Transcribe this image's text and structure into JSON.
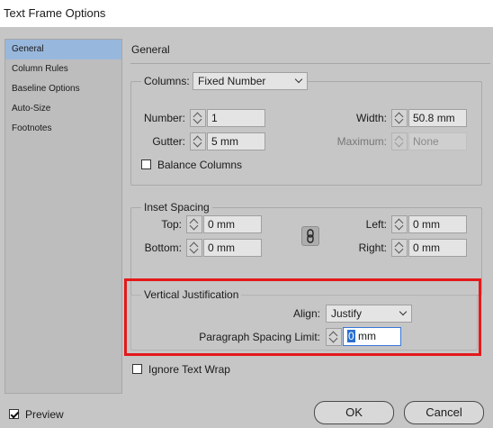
{
  "window": {
    "title": "Text Frame Options"
  },
  "sidebar": {
    "items": [
      {
        "label": "General"
      },
      {
        "label": "Column Rules"
      },
      {
        "label": "Baseline Options"
      },
      {
        "label": "Auto-Size"
      },
      {
        "label": "Footnotes"
      }
    ]
  },
  "main": {
    "section_title": "General",
    "columns": {
      "label": "Columns:",
      "type_value": "Fixed Number",
      "number_label": "Number:",
      "number_value": "1",
      "gutter_label": "Gutter:",
      "gutter_value": "5 mm",
      "width_label": "Width:",
      "width_value": "50.8 mm",
      "maximum_label": "Maximum:",
      "maximum_value": "None",
      "balance_label": "Balance Columns",
      "balance_checked": false
    },
    "inset": {
      "legend": "Inset Spacing",
      "top_label": "Top:",
      "top_value": "0 mm",
      "bottom_label": "Bottom:",
      "bottom_value": "0 mm",
      "left_label": "Left:",
      "left_value": "0 mm",
      "right_label": "Right:",
      "right_value": "0 mm"
    },
    "vertical": {
      "legend": "Vertical Justification",
      "align_label": "Align:",
      "align_value": "Justify",
      "psl_label": "Paragraph Spacing Limit:",
      "psl_selected": "0",
      "psl_rest": " mm"
    },
    "ignore_wrap": {
      "label": "Ignore Text Wrap",
      "checked": false
    }
  },
  "footer": {
    "preview_label": "Preview",
    "preview_checked": true,
    "ok_label": "OK",
    "cancel_label": "Cancel"
  },
  "colors": {
    "highlight": "#e3191b",
    "selection": "#2a6fcf",
    "sidebar_active": "#98b7dc"
  }
}
